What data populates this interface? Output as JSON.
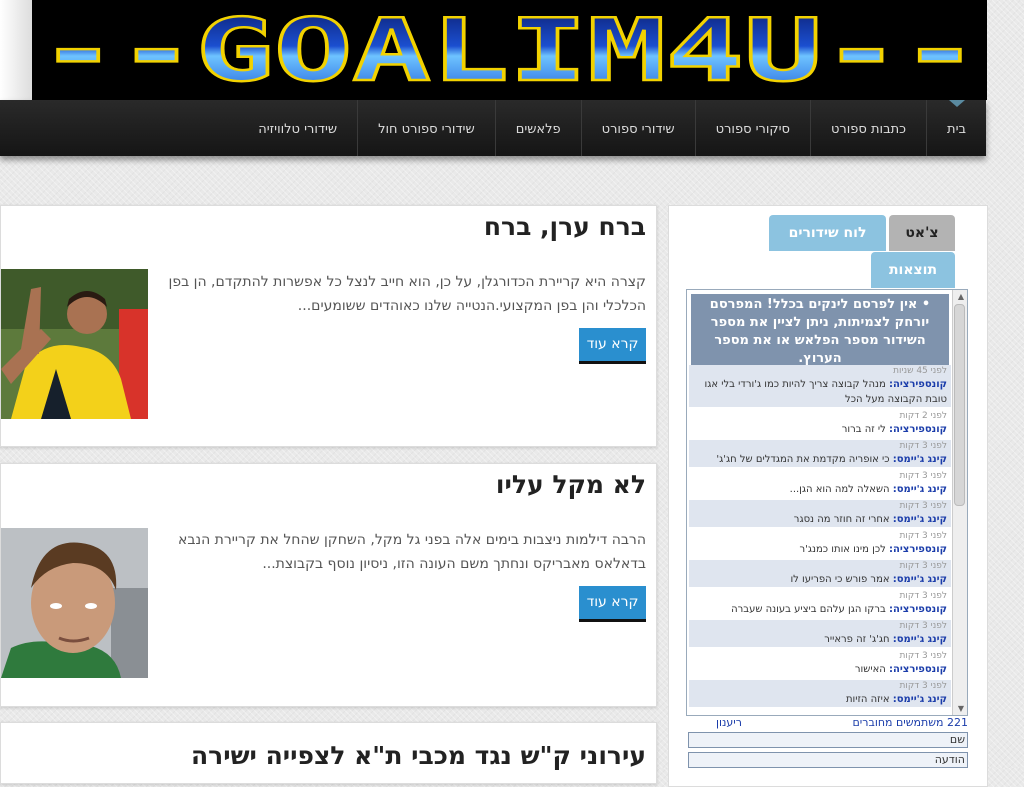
{
  "header": {
    "logo_text": "--GOALIM4U--",
    "colors": {
      "logo_fill": "#2a7be8",
      "logo_outline": "#f2d200",
      "background": "#000000"
    }
  },
  "nav": {
    "items": [
      {
        "label": "בית"
      },
      {
        "label": "כתבות ספורט"
      },
      {
        "label": "סיקורי ספורט"
      },
      {
        "label": "שידורי ספורט"
      },
      {
        "label": "פלאשים"
      },
      {
        "label": "שידורי ספורט חול"
      },
      {
        "label": "שידורי טלוויזיה"
      }
    ]
  },
  "posts": [
    {
      "title": "ברח ערן, ברח",
      "excerpt": "קצרה היא קריירת הכדורגלן, על כן, הוא חייב לנצל כל אפשרות להתקדם, הן בפן הכלכלי והן בפן המקצועי.הנטייה שלנו כאוהדים ששומעים...",
      "read_more": "קרא עוד"
    },
    {
      "title": "לא מקל עליו",
      "excerpt": "הרבה דילמות ניצבות בימים אלה בפני גל מקל, השחקן שהחל את קריירת הנבא בדאלאס מאבריקס ונחתך משם העונה הזו, ניסיון נוסף בקבוצת...",
      "read_more": "קרא עוד"
    },
    {
      "title": "עירוני ק\"ש נגד מכבי ת\"א לצפייה ישירה"
    }
  ],
  "sidebar": {
    "tabs": {
      "chat": "צ'אט",
      "schedule": "לוח שידורים",
      "results": "תוצאות"
    },
    "notice": "• אין לפרסם לינקים בכלל! המפרסם יורחק לצמיתות, ניתן לציין את מספר השידור מספר הפלאש או את מספר הערוץ.",
    "messages": [
      {
        "time": "לפני 45 שניות",
        "user": "קונספירציה:",
        "text": "מנהל קבוצה צריך להיות כמו ג'ורדי בלי אגו טובת הקבוצה מעל הכל"
      },
      {
        "time": "לפני 2 דקות",
        "user": "קונספירציה:",
        "text": "לי זה ברור"
      },
      {
        "time": "לפני 3 דקות",
        "user": "קינג ג'יימס:",
        "text": "כי אופריה מקדמת את המגדלים של חג'ג'"
      },
      {
        "time": "לפני 3 דקות",
        "user": "קינג ג'יימס:",
        "text": "השאלה למה הוא הגן..."
      },
      {
        "time": "לפני 3 דקות",
        "user": "קינג ג'יימס:",
        "text": "אחרי זה חוזר מה נסגר"
      },
      {
        "time": "לפני 3 דקות",
        "user": "קונספירציה:",
        "text": "לכן מינו אותו כמנג'ר"
      },
      {
        "time": "לפני 3 דקות",
        "user": "קינג ג'יימס:",
        "text": "אמר פורש כי הפריעו לו"
      },
      {
        "time": "לפני 3 דקות",
        "user": "קונספירציה:",
        "text": "ברקו הגן עלהם ביציע בעונה שעברה"
      },
      {
        "time": "לפני 3 דקות",
        "user": "קינג ג'יימס:",
        "text": "חג'ג' זה פראייר"
      },
      {
        "time": "לפני 3 דקות",
        "user": "קונספירציה:",
        "text": "האישור"
      },
      {
        "time": "לפני 3 דקות",
        "user": "קינג ג'יימס:",
        "text": "איזה הזיות"
      }
    ],
    "footer": {
      "online": "221 משתמשים מחוברים",
      "rianon": "ריענון",
      "name_placeholder": "שם",
      "message_placeholder": "הודעה"
    }
  }
}
